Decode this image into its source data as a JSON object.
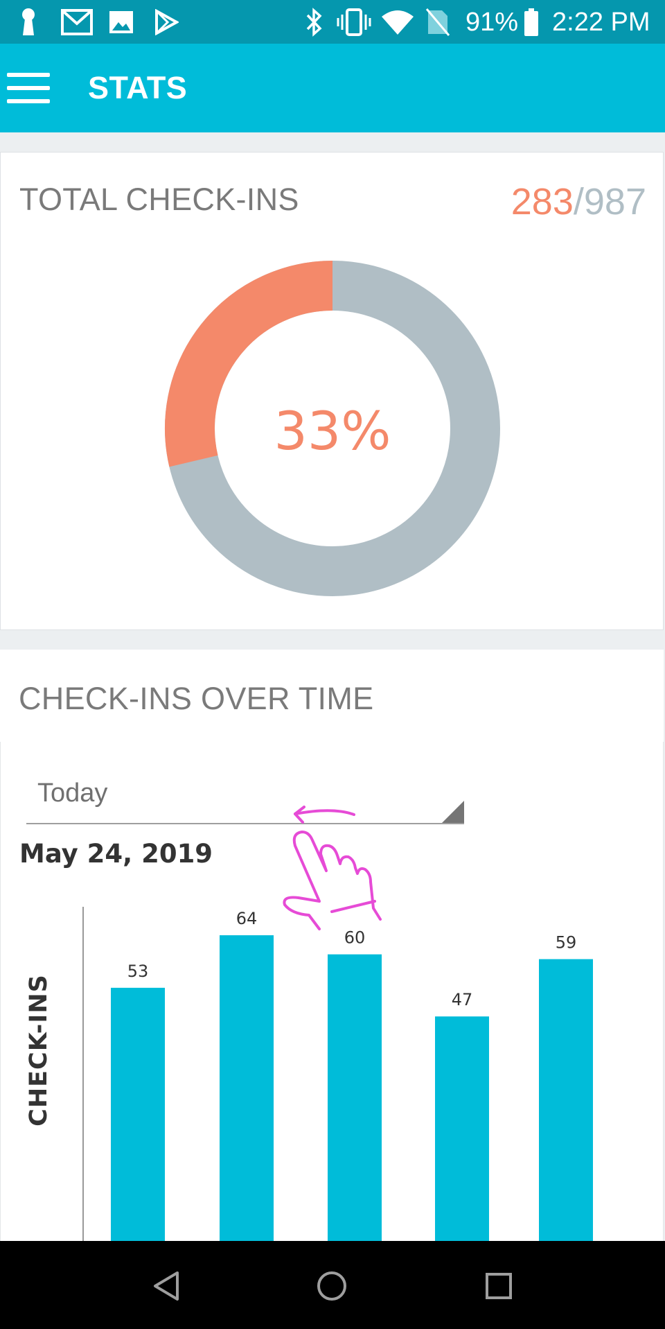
{
  "status_bar": {
    "battery": "91%",
    "time": "2:22 PM",
    "icons": [
      "keyhole-icon",
      "gmail-icon",
      "image-icon",
      "play-store-icon",
      "bluetooth-icon",
      "vibrate-icon",
      "wifi-icon",
      "no-sim-icon",
      "battery-icon"
    ]
  },
  "app_bar": {
    "title": "STATS",
    "menu_icon": "hamburger-menu-icon"
  },
  "total_checkins": {
    "title": "TOTAL CHECK-INS",
    "checked": "283",
    "separator": "/",
    "total": "987",
    "percent_label": "33%"
  },
  "over_time": {
    "title": "CHECK-INS OVER TIME",
    "range_select": {
      "value": "Today"
    },
    "date": "May 24, 2019"
  },
  "colors": {
    "status_bar": "#0597AE",
    "app_bar": "#00BCD9",
    "checked": "#F4896A",
    "remaining": "#B0BEC5",
    "bar": "#00BCD9",
    "gesture": "#E64BD6"
  },
  "chart_data": [
    {
      "type": "pie",
      "variant": "donut",
      "values": [
        283,
        704
      ],
      "colors": [
        "#F4896A",
        "#B0BEC5"
      ],
      "center_label": "33%"
    },
    {
      "type": "bar",
      "ylabel": "CHECK-INS",
      "values": [
        53,
        64,
        60,
        47,
        59
      ],
      "data_labels": [
        "53",
        "64",
        "60",
        "47",
        "59"
      ],
      "ymax": 100,
      "color": "#00BCD9"
    }
  ],
  "nav_bar": {
    "icons": [
      "back-icon",
      "home-icon",
      "recents-icon"
    ]
  },
  "overlay": {
    "icon": "swipe-left-hand-icon"
  }
}
